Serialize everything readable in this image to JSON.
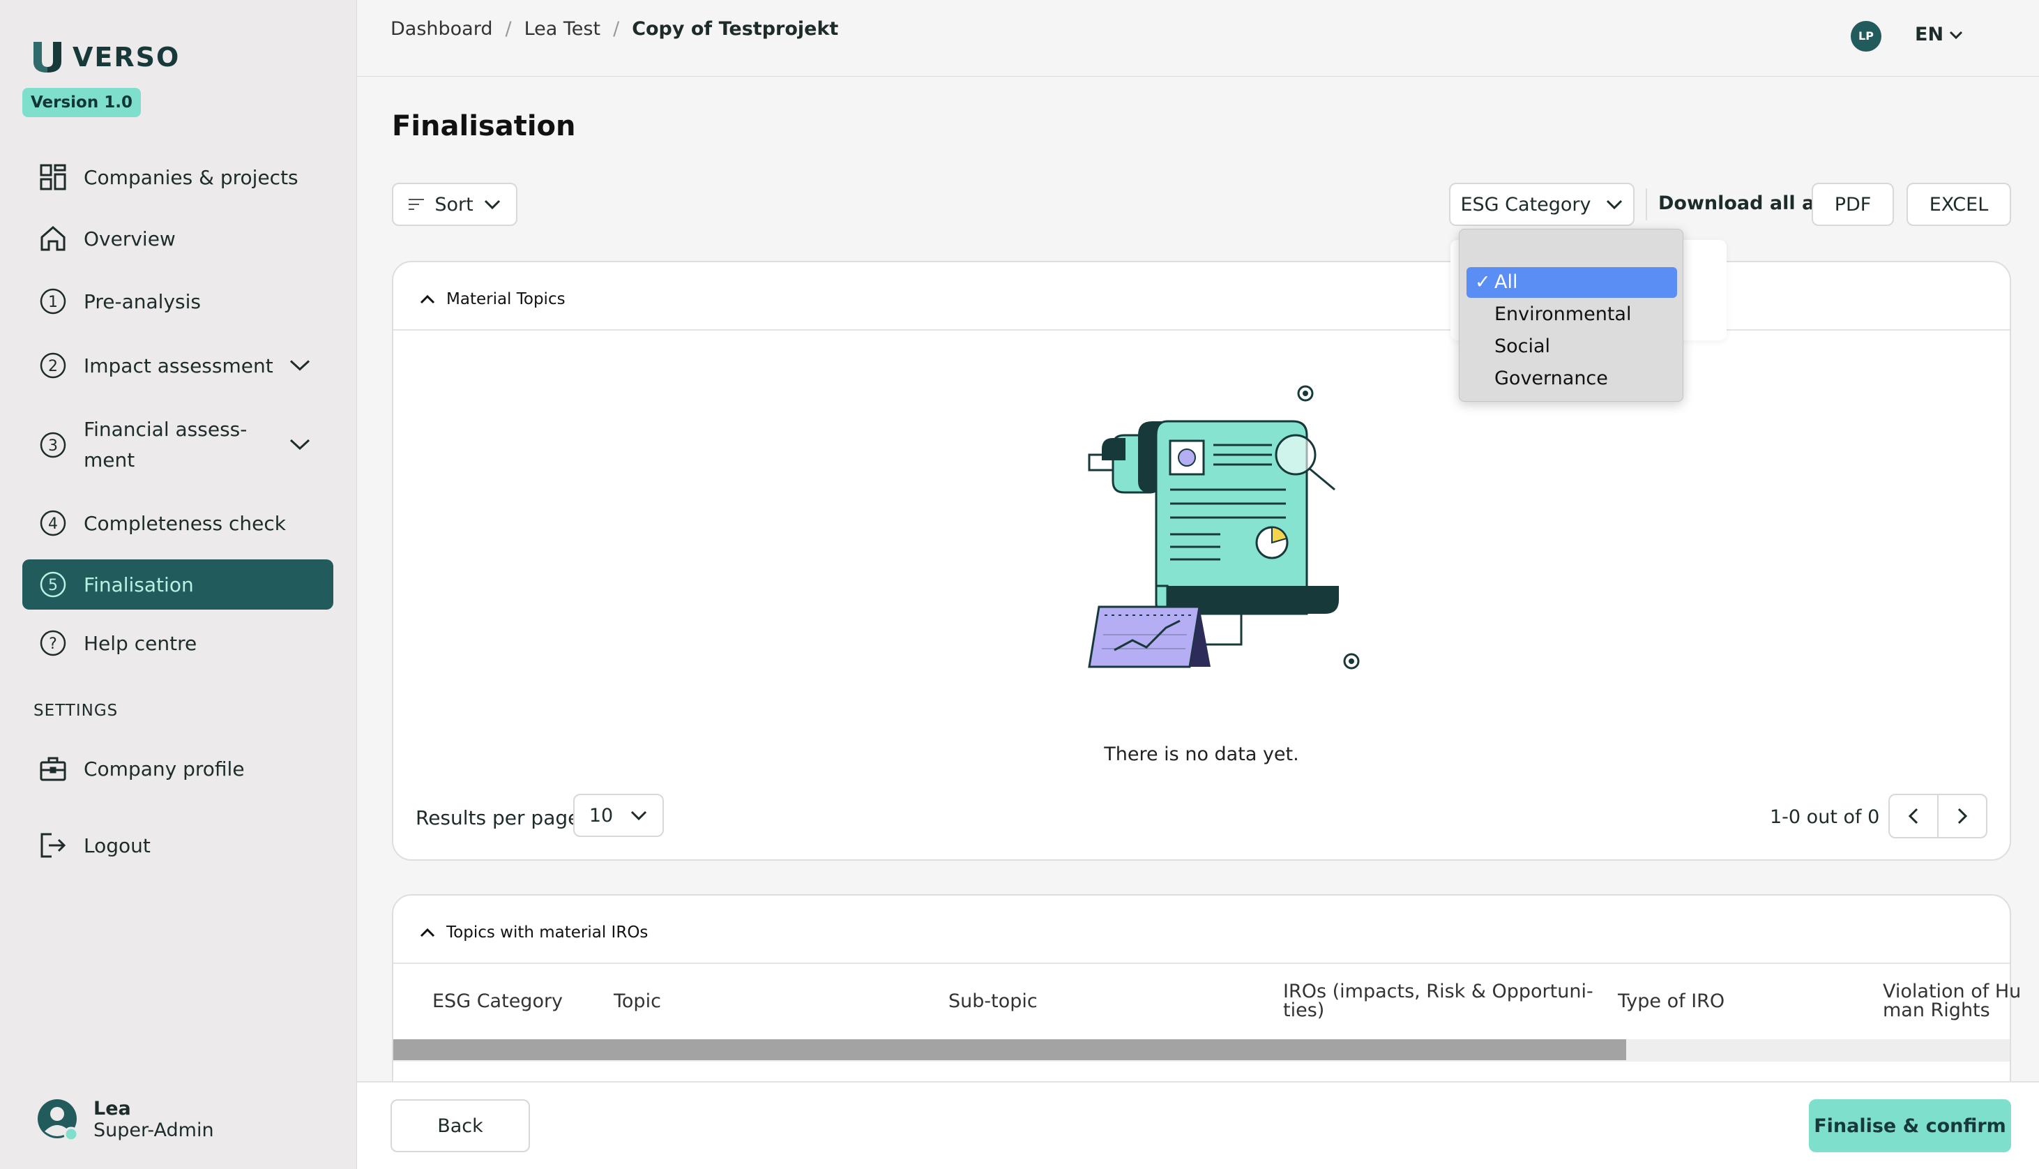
{
  "app": {
    "name": "VERSO",
    "version": "Version 1.0"
  },
  "sidebar": {
    "items": [
      {
        "label": "Companies & projects",
        "icon": "grid-icon"
      },
      {
        "label": "Overview",
        "icon": "home-icon"
      },
      {
        "label": "Pre-analysis",
        "icon": "step-1-icon",
        "step": "1"
      },
      {
        "label": "Impact assessment",
        "icon": "step-2-icon",
        "step": "2"
      },
      {
        "label": "Financial assess-ment",
        "line1": "Financial assess-",
        "line2": "ment",
        "icon": "step-3-icon",
        "step": "3"
      },
      {
        "label": "Completeness check",
        "icon": "step-4-icon",
        "step": "4"
      },
      {
        "label": "Finalisation",
        "icon": "step-5-icon",
        "step": "5"
      },
      {
        "label": "Help centre",
        "icon": "help-icon",
        "step": "?"
      }
    ],
    "settings_label": "SETTINGS",
    "company_profile": "Company profile",
    "logout": "Logout",
    "user": {
      "name": "Lea",
      "role": "Super-Admin"
    }
  },
  "header": {
    "breadcrumb": [
      "Dashboard",
      "Lea Test",
      "Copy of Testprojekt"
    ],
    "avatar_initials": "LP",
    "language": "EN"
  },
  "page": {
    "title": "Finalisation"
  },
  "toolbar": {
    "sort_label": "Sort",
    "esg_category_label": "ESG Category",
    "download_label": "Download all as",
    "pdf_label": "PDF",
    "excel_label": "EXCEL"
  },
  "dropdown": {
    "options": [
      "All",
      "Environmental",
      "Social",
      "Governance"
    ],
    "selected": "All",
    "check": "✓"
  },
  "material_topics": {
    "title": "Material Topics",
    "empty_text": "There is no data yet.",
    "results_per_page_label": "Results per page",
    "results_per_page_value": "10",
    "pagination_text": "1-0 out of 0"
  },
  "iros_section": {
    "title": "Topics with material IROs",
    "columns": [
      "ESG Category",
      "Topic",
      "Sub-topic",
      "IROs (impacts, Risk & Opportuni-ties)",
      "Type of IRO",
      "Violation of Hu-man Rights"
    ],
    "col4_l1": "IROs (impacts, Risk & Opportuni-",
    "col4_l2": "ties)",
    "col6_l1": "Violation of Hu",
    "col6_l2": "man Rights"
  },
  "footer": {
    "back_label": "Back",
    "finalise_label": "Finalise & confirm"
  },
  "colors": {
    "accent": "#215b5b",
    "mint": "#7ee0cc",
    "finalise_button": "#7ee0cc",
    "dropdown_selected": "#5b8ef5"
  }
}
